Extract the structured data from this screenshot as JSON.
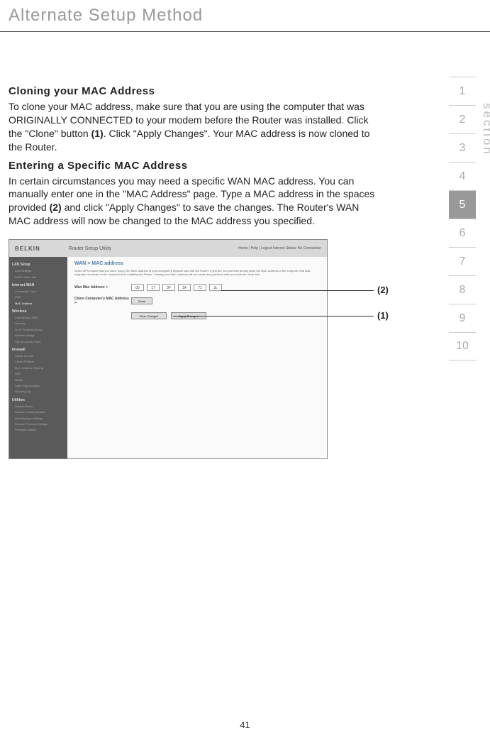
{
  "header": {
    "title": "Alternate Setup Method"
  },
  "section1": {
    "heading": "Cloning your MAC Address",
    "text_part1": "To clone your MAC address, make sure that you are using the computer that was ORIGINALLY CONNECTED to your modem before the Router was installed. Click the \"Clone\" button ",
    "ref1": "(1)",
    "text_part2": ". Click \"Apply Changes\". Your MAC address is now cloned to the Router."
  },
  "section2": {
    "heading": "Entering a Specific MAC Address",
    "text_part1": "In certain circumstances you may need a specific WAN MAC address. You can manually enter one in the \"MAC Address\" page. Type a MAC address in the spaces provided ",
    "ref2": "(2)",
    "text_part2": " and click \"Apply Changes\" to save the changes. The Router's WAN MAC address will now be changed to the MAC address you specified."
  },
  "tabs": {
    "items": [
      "1",
      "2",
      "3",
      "4",
      "5",
      "6",
      "7",
      "8",
      "9",
      "10"
    ],
    "active_index": 4,
    "label": "section"
  },
  "screenshot": {
    "logo": "BELKIN",
    "utility": "Router Setup Utility",
    "status": "Home | Help | Logout   Internet Status: No Connection",
    "breadcrumb": "WAN > MAC address",
    "desc": "Some ISPs require that you clone (copy) the MAC address of your computer's network card into the Router. If you are not sure then simply clone the MAC address of the computer that was originally connected to the modem before installing the Router. Cloning your MAC address will not cause any problems with your network. More Info",
    "row1_label": "Wan Mac Address >",
    "mac_values": [
      "00",
      "17",
      "3F",
      "1A",
      "71",
      "3c"
    ],
    "row2_label": "Clone Computer's MAC Address >",
    "clone_btn": "Clone",
    "clear_btn": "Clear Changes",
    "apply_btn": "Apply Changes",
    "sidebar": {
      "h1": "LAN Setup",
      "h1_items": [
        "LAN Settings",
        "DHCP Client List"
      ],
      "h2": "Internet WAN",
      "h2_items": [
        "Connection Type",
        "DNS",
        "MAC Address"
      ],
      "h3": "Wireless",
      "h3_items": [
        "Channel and SSID",
        "Security",
        "Wi-Fi Protected Setup",
        "Wireless Bridge",
        "Use as Access Point"
      ],
      "h4": "Firewall",
      "h4_items": [
        "Virtual Servers",
        "Client IP Filters",
        "MAC Address Filtering",
        "DMZ",
        "DDNS",
        "WAN Ping Blocking",
        "Security Log"
      ],
      "h5": "Utilities",
      "h5_items": [
        "Restart Router",
        "Restore Factory Default",
        "Save/Backup Settings",
        "Restore Previous Settings",
        "Firmware Update"
      ]
    }
  },
  "callouts": {
    "label1": "(1)",
    "label2": "(2)"
  },
  "page_number": "41"
}
